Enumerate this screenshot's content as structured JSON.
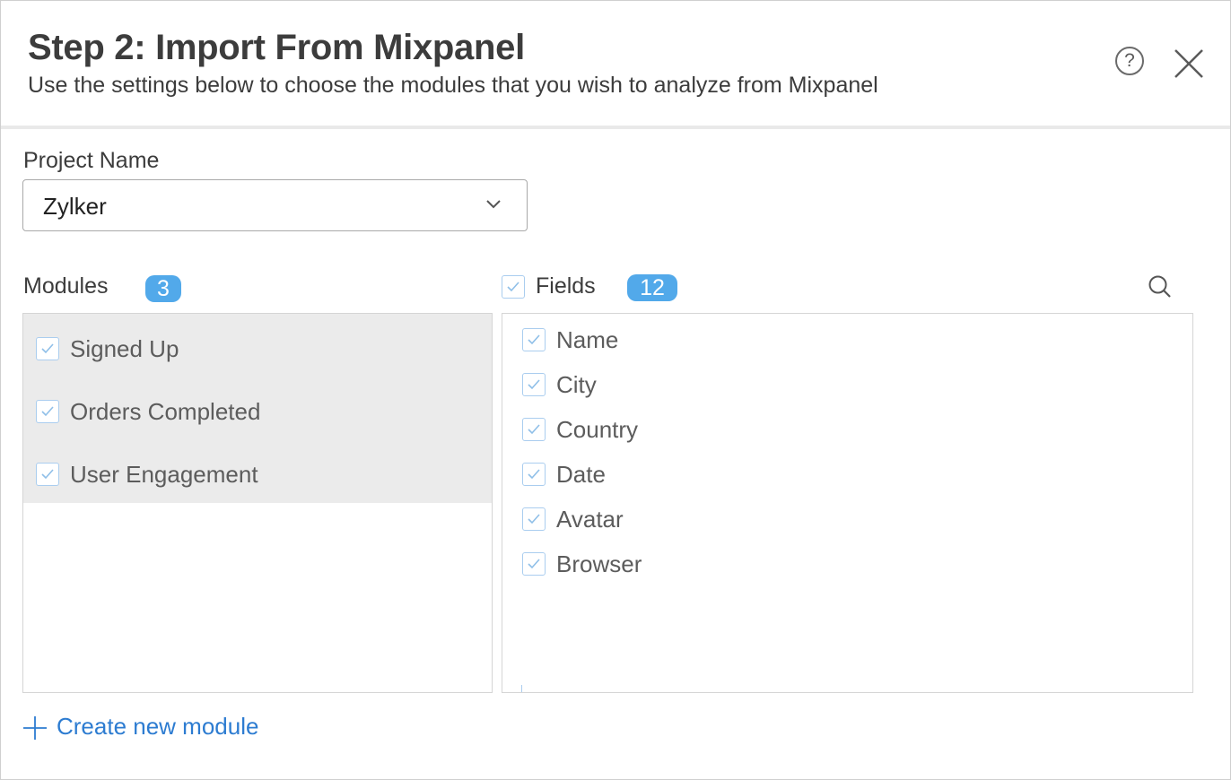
{
  "dialog": {
    "title": "Step 2: Import From Mixpanel",
    "subtitle": "Use the settings below to choose the modules that you wish to analyze from Mixpanel",
    "help_icon": "question-circle-icon",
    "help_symbol": "?",
    "close_icon": "close-icon"
  },
  "project": {
    "label": "Project Name",
    "selected": "Zylker",
    "dropdown_icon": "chevron-down-icon"
  },
  "modules": {
    "label": "Modules",
    "count": "3",
    "items": [
      {
        "label": "Signed Up",
        "checked": true
      },
      {
        "label": "Orders Completed",
        "checked": true
      },
      {
        "label": "User Engagement",
        "checked": true
      }
    ]
  },
  "fields": {
    "label": "Fields",
    "count": "12",
    "all_checked": true,
    "search_icon": "search-icon",
    "items": [
      {
        "label": "Name",
        "checked": true
      },
      {
        "label": "City",
        "checked": true
      },
      {
        "label": "Country",
        "checked": true
      },
      {
        "label": "Date",
        "checked": true
      },
      {
        "label": "Avatar",
        "checked": true
      },
      {
        "label": "Browser",
        "checked": true
      }
    ]
  },
  "actions": {
    "create_module": "Create new module",
    "create_icon": "plus-icon"
  },
  "colors": {
    "accent": "#52a9ea",
    "link": "#2d7cd1",
    "checkbox_border": "#aacdef",
    "selected_row_bg": "#ebebeb"
  }
}
